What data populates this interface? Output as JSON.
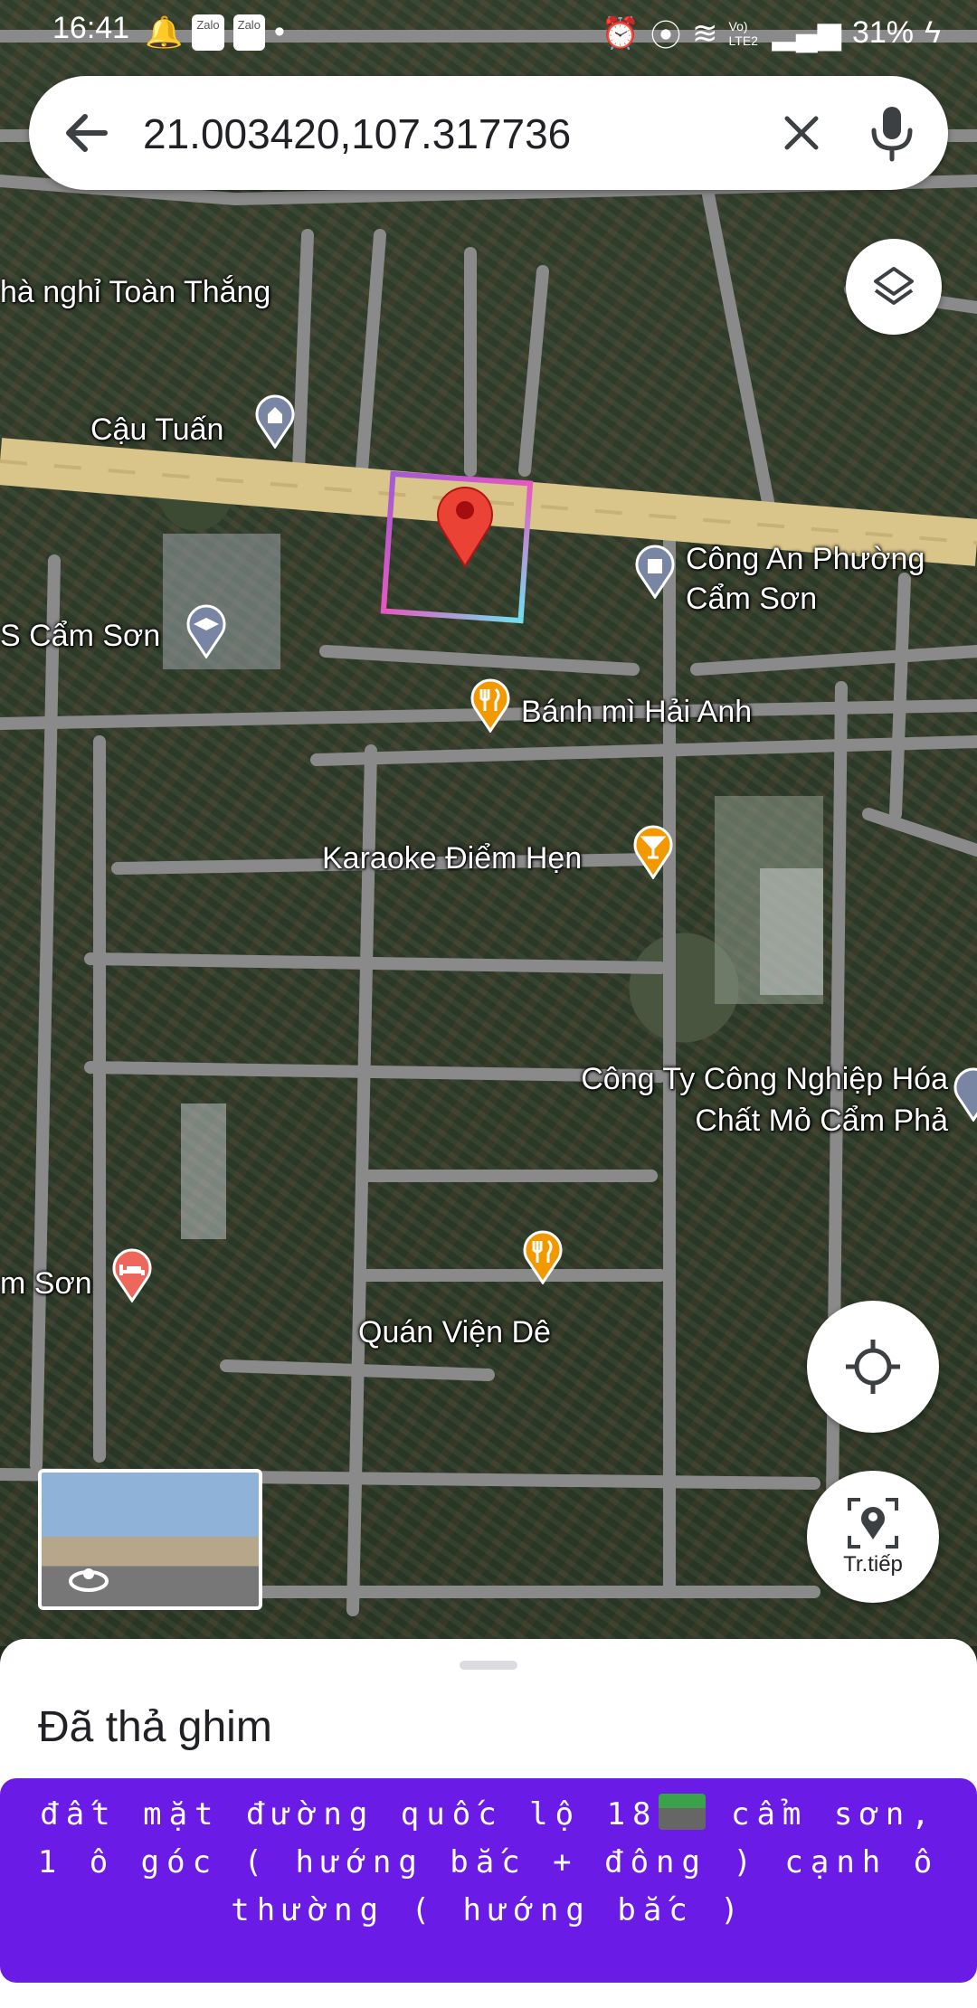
{
  "status_bar": {
    "time": "16:41",
    "chips": [
      "Zalo",
      "Zalo"
    ],
    "network_label": "Vo) LTE2",
    "battery": "31%"
  },
  "search": {
    "query": "21.003420,107.317736"
  },
  "map": {
    "labels": [
      "hà nghỉ Toàn Thắng",
      "Cậu Tuấn",
      "Công An Phường Cẩm Sơn",
      "S Cẩm Sơn",
      "Bánh mì Hải Anh",
      "Karaoke Điểm Hẹn",
      "Công Ty Công Nghiệp Hóa Chất Mỏ Cẩm Phả",
      "m Sơn",
      "Quán Viện Dê"
    ],
    "poi_colors": {
      "restaurant": "#f29900",
      "bar": "#f29900",
      "hotel": "#ee675c",
      "government": "#7986a3",
      "dropped_pin": "#ea4335",
      "road": "#8a8a8a",
      "highway": "#d9c48a"
    }
  },
  "buttons": {
    "live_label": "Tr.tiếp"
  },
  "sheet": {
    "title": "Đã thả ghim"
  },
  "caption": {
    "text_before_emoji": "đất mặt đường quốc lộ 18",
    "text_after_emoji": " cẩm sơn, 1 ô góc ( hướng bắc + đông ) cạnh ô thường ( hướng bắc )",
    "background": "#6a1be6"
  }
}
